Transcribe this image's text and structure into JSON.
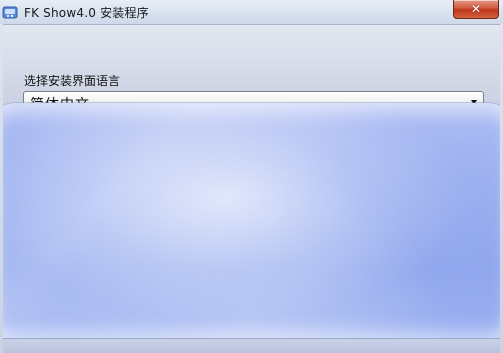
{
  "window": {
    "title": "FK Show4.0 安装程序",
    "close_symbol": "✕"
  },
  "main": {
    "language_label": "选择安装界面语言",
    "language_select": {
      "selected_value": "简体中文"
    }
  },
  "icons": {
    "app": "app-logo-icon",
    "close": "close-icon",
    "dropdown": "chevron-down-icon"
  },
  "colors": {
    "close_button": "#c1371b",
    "panel_blue": "#98adf0"
  }
}
